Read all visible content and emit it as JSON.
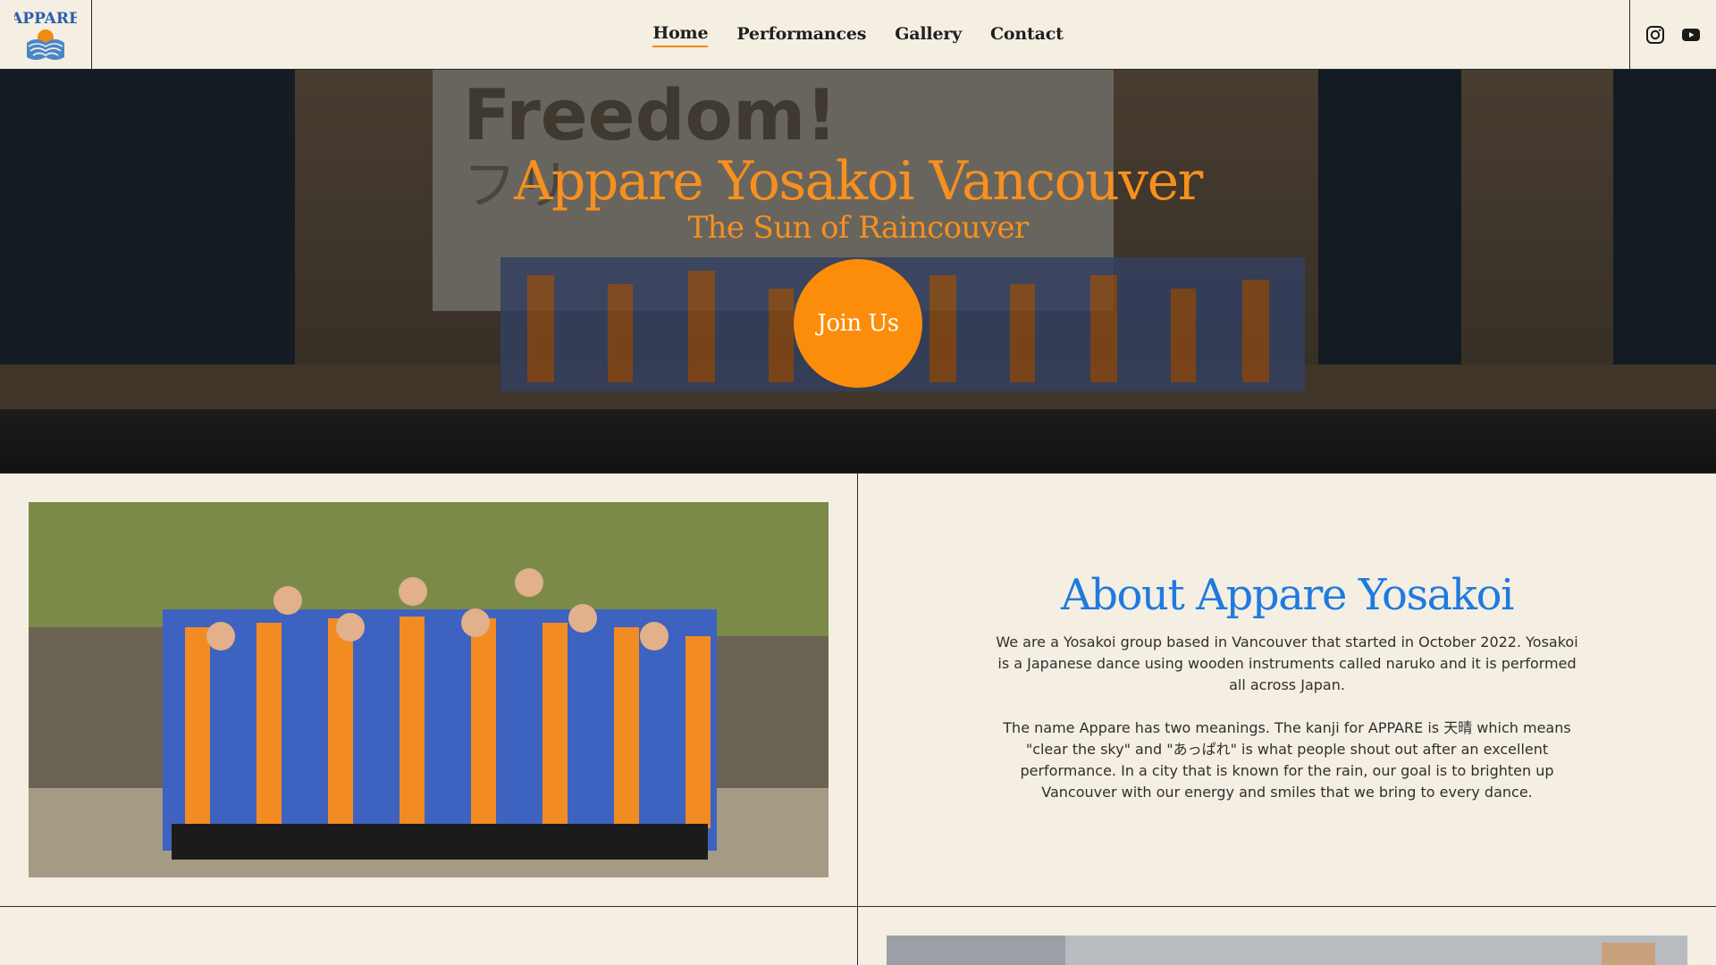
{
  "brand": {
    "logo_text": "APPARE",
    "logo_subtext": "Yosakoi Vancouver"
  },
  "nav": {
    "items": [
      {
        "label": "Home",
        "active": true
      },
      {
        "label": "Performances",
        "active": false
      },
      {
        "label": "Gallery",
        "active": false
      },
      {
        "label": "Contact",
        "active": false
      }
    ]
  },
  "social": {
    "icons": [
      "instagram-icon",
      "youtube-icon"
    ]
  },
  "hero": {
    "title": "Appare Yosakoi Vancouver",
    "subtitle": "The Sun of Raincouver",
    "cta_label": "Join Us",
    "screen_text": "Freedom!",
    "screen_kana": "フリ"
  },
  "about": {
    "title": "About Appare Yosakoi",
    "paragraph1": "We are a Yosakoi group based in Vancouver that started in October 2022. Yosakoi is a Japanese dance using wooden instruments called naruko and it is performed all across Japan.",
    "paragraph2": "The name Appare has two meanings. The kanji for APPARE is 天晴 which means \"clear the sky\" and \"あっぱれ\" is what people shout out after an excellent performance. In a city that is known for the rain, our goal is to brighten up Vancouver with our energy and smiles that we bring to every dance."
  },
  "colors": {
    "background": "#f4efe2",
    "accent_orange": "#f7901e",
    "button_orange": "#fb8d0b",
    "about_blue": "#1f7ae0",
    "ink": "#2b2b2b"
  }
}
